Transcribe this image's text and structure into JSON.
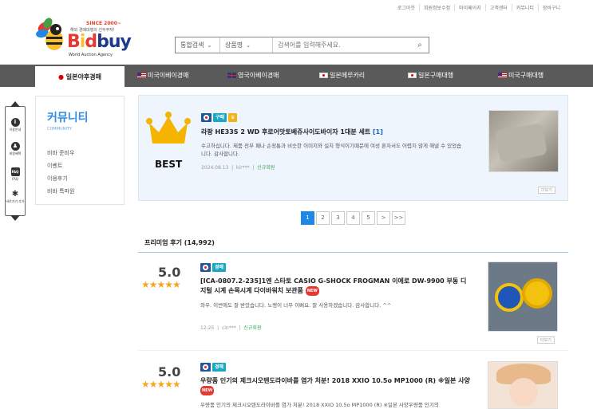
{
  "toplinks": [
    "로그아웃",
    "회원정보수정",
    "마이페이지",
    "고객센터",
    "커뮤니티",
    "장바구니"
  ],
  "logo": {
    "since": "SINCE 2000~",
    "tagline": "해외 경매대행의 선두주자!",
    "word": "Bidbuy",
    "sub": "World Auction Agency"
  },
  "search": {
    "category": "통합검색",
    "type": "상품명",
    "placeholder": "검색어를 입력해주세요."
  },
  "nav": [
    "일본야후경매",
    "미국이베이경매",
    "영국이베이경매",
    "일본메루카리",
    "일본구매대행",
    "미국구매대행"
  ],
  "quick": [
    "이용안내",
    "회원혜택",
    "FAQ",
    "바로가기 추가"
  ],
  "sidebar": {
    "title": "커뮤니티",
    "en": "COMMUNITY",
    "items": [
      "비바 준비우",
      "이벤트",
      "이용후기",
      "비바 특파원"
    ]
  },
  "best": {
    "label": "BEST",
    "chip": "구매",
    "title": "라팡 HE33S 2 WD 후로어맛토베쥬사이도바이자 1대분 세트",
    "count": "[1]",
    "desc": "수고하십니다. 제품 전부 패나 손정통과 비슷한 이미지와 실치 형식이기때문에 여성 혼자서도 어렵지 않게 해낼 수 있었습니다. 감사합니다.",
    "date": "2024.08.13",
    "user": "kir***",
    "group": "신규회원",
    "more": "더보기"
  },
  "pager": [
    "1",
    "2",
    "3",
    "4",
    "5",
    ">",
    ">>"
  ],
  "section": "프리미엄 후기 (14,992)",
  "reviews": [
    {
      "score": "5.0",
      "stars": "★★★★★",
      "chip": "경매",
      "title": "[ICA-0807.2-235]1엔 스타토 CASIO G-SHOCK FROGMAN 이에로 DW-9900 부동 디지털 시계 손목시계 다이바워치 보관품",
      "new": "NEW",
      "desc": "와우. 이번에도 잘 받았습니다. 노랭이 너무 이뻐요. 잘 사용하겠습니다. 감사합니다. ^^",
      "date": "12:25",
      "user": "cin***",
      "group": "신규회원",
      "more": "더보기"
    },
    {
      "score": "5.0",
      "stars": "★★★★★",
      "chip": "경매",
      "title": "우량품 인기의 제크시오텐도라이바를 염가 처분! 2018 XXIO 10.5o MP1000 (R) ※일본 사양",
      "new": "NEW",
      "desc": "우량품 인기의 제크시오텐도라이바를 염가 처분! 2018 XXIO 10.5o MP1000 (R) ※일본 사양우량품 인기의"
    }
  ],
  "colors": {
    "nav": "#5a5a5a",
    "accent": "#1e88e5",
    "star": "#f5a623",
    "bestBg": "#eef5fc"
  }
}
